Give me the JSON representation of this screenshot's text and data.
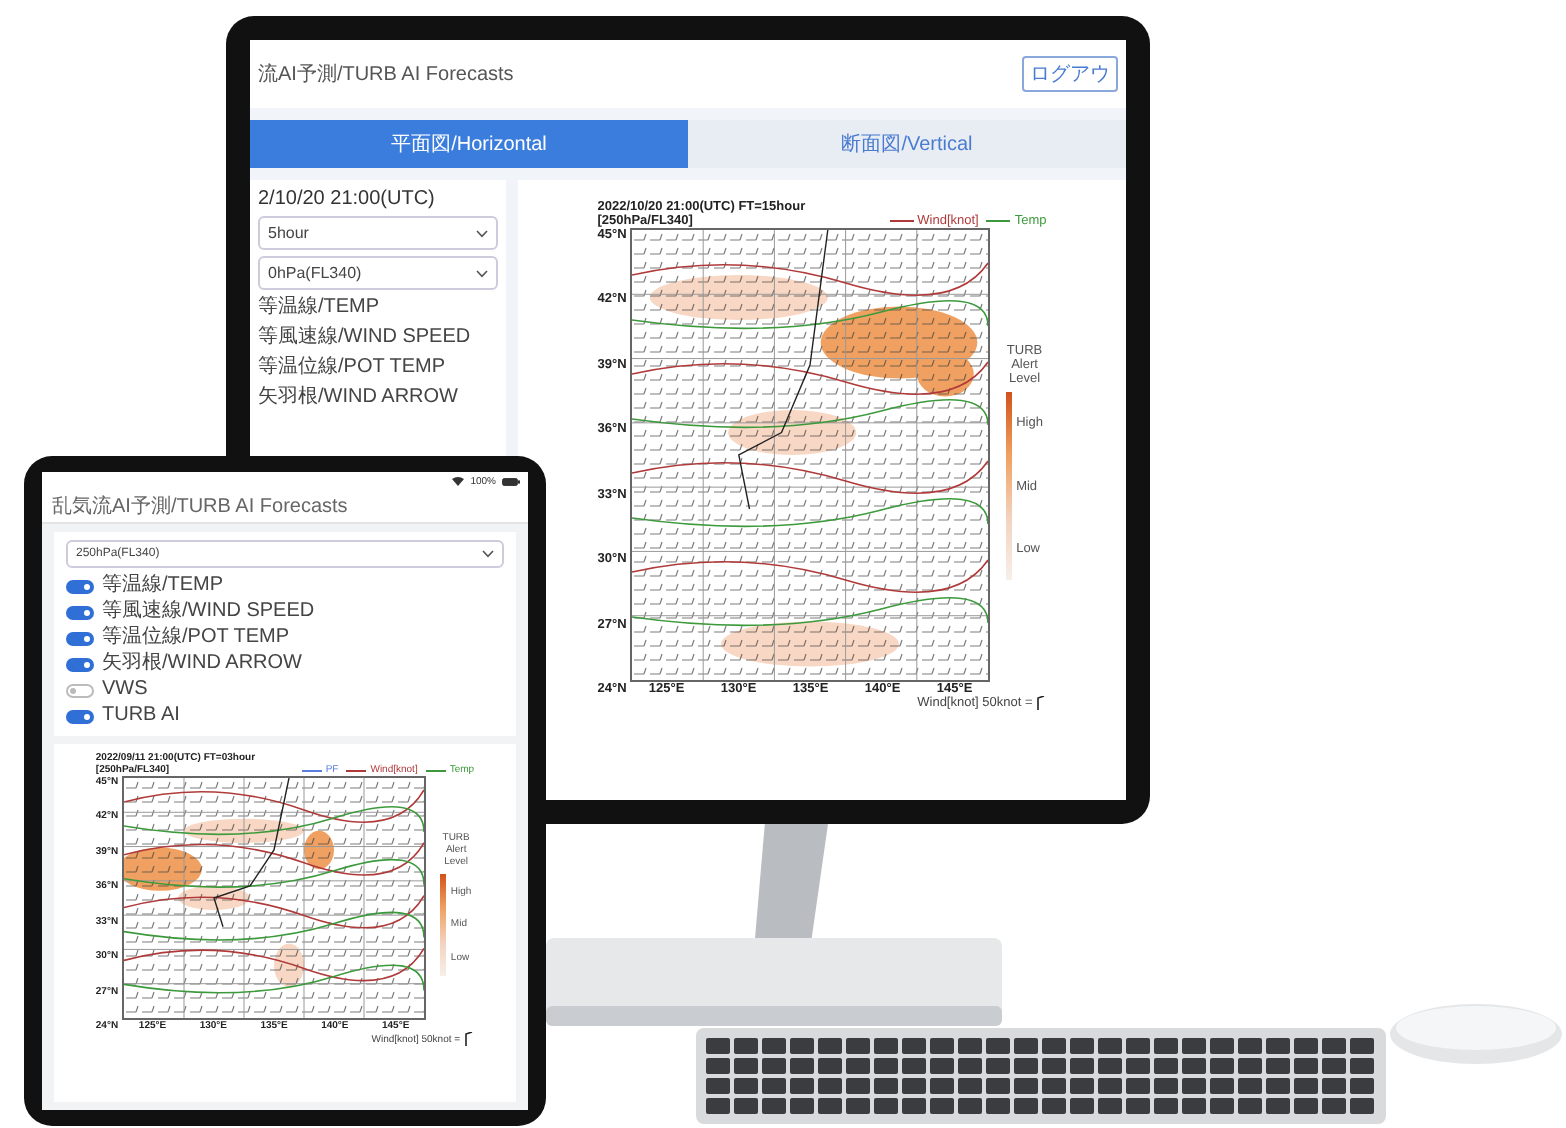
{
  "monitor": {
    "app_title": "流AI予測/TURB AI Forecasts",
    "logout_button": "ログアウ",
    "tabs": [
      {
        "label": "平面図/Horizontal",
        "selected": true
      },
      {
        "label": "断面図/Vertical",
        "selected": false
      }
    ],
    "sidebar": {
      "datetime": "2/10/20 21:00(UTC)",
      "selects": [
        {
          "value": "5hour"
        },
        {
          "value": "0hPa(FL340)"
        }
      ],
      "layers": [
        {
          "label": "等温線/TEMP"
        },
        {
          "label": "等風速線/WIND SPEED"
        },
        {
          "label": "等温位線/POT TEMP"
        },
        {
          "label": "矢羽根/WIND ARROW"
        }
      ]
    },
    "chart": {
      "title": "2022/10/20 21:00(UTC) FT=15hour",
      "subtitle": "[250hPa/FL340]",
      "legend": [
        {
          "label": "Wind[knot]",
          "color": "#b03a3a"
        },
        {
          "label": "Temp",
          "color": "#3c9a3c"
        }
      ],
      "lat_labels": [
        "45°N",
        "42°N",
        "39°N",
        "36°N",
        "33°N",
        "30°N",
        "27°N",
        "24°N"
      ],
      "lon_labels": [
        "125°E",
        "130°E",
        "135°E",
        "140°E",
        "145°E"
      ],
      "colorbar": {
        "title": "TURB Alert Level",
        "labels": [
          "High",
          "Mid",
          "Low"
        ]
      },
      "footnote": "Wind[knot] 50knot ="
    }
  },
  "tablet": {
    "battery": "100%",
    "app_title": "乱気流AI予測/TURB AI Forecasts",
    "select": {
      "value": "250hPa(FL340)"
    },
    "toggles": [
      {
        "label": "等温線/TEMP",
        "on": true
      },
      {
        "label": "等風速線/WIND SPEED",
        "on": true
      },
      {
        "label": "等温位線/POT TEMP",
        "on": true
      },
      {
        "label": "矢羽根/WIND ARROW",
        "on": true
      },
      {
        "label": "VWS",
        "on": false
      },
      {
        "label": "TURB AI",
        "on": true
      }
    ],
    "chart": {
      "title": "2022/09/11 21:00(UTC) FT=03hour",
      "subtitle": "[250hPa/FL340]",
      "legend": [
        {
          "label": "PF",
          "color": "#5b7fe0"
        },
        {
          "label": "Wind[knot]",
          "color": "#b03a3a"
        },
        {
          "label": "Temp",
          "color": "#3c9a3c"
        }
      ],
      "lat_labels": [
        "45°N",
        "42°N",
        "39°N",
        "36°N",
        "33°N",
        "30°N",
        "27°N",
        "24°N"
      ],
      "lon_labels": [
        "125°E",
        "130°E",
        "135°E",
        "140°E",
        "145°E"
      ],
      "colorbar": {
        "title": "TURB Alert Level",
        "labels": [
          "High",
          "Mid",
          "Low"
        ]
      },
      "footnote": "Wind[knot] 50knot ="
    }
  }
}
